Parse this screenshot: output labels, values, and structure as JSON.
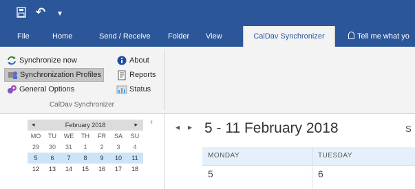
{
  "title_bar": {
    "undo_glyph": "↶",
    "qat_more_glyph": "▾"
  },
  "tabs": [
    {
      "label": "File"
    },
    {
      "label": "Home"
    },
    {
      "label": "Send / Receive"
    },
    {
      "label": "Folder"
    },
    {
      "label": "View"
    },
    {
      "label": "CalDav Synchronizer"
    },
    {
      "label": "Tell me what yo"
    }
  ],
  "ribbon": {
    "buttons": {
      "sync_now": "Synchronize now",
      "profiles": "Synchronization Profiles",
      "general": "General Options",
      "about": "About",
      "reports": "Reports",
      "status": "Status"
    },
    "group_label": "CalDav Synchronizer"
  },
  "mini_calendar": {
    "month": "February 2018",
    "prev": "◂",
    "next": "▸",
    "collapse": "‹",
    "weekdays": [
      "MO",
      "TU",
      "WE",
      "TH",
      "FR",
      "SA",
      "SU"
    ],
    "weeks": [
      [
        "29",
        "30",
        "31",
        "1",
        "2",
        "3",
        "4"
      ],
      [
        "5",
        "6",
        "7",
        "8",
        "9",
        "10",
        "11"
      ],
      [
        "12",
        "13",
        "14",
        "15",
        "16",
        "17",
        "18"
      ]
    ]
  },
  "main": {
    "nav_prev": "◂",
    "nav_next": "▸",
    "range_title": "5 - 11 February 2018",
    "tz_partial": "S",
    "days": [
      {
        "header": "MONDAY",
        "date": "5"
      },
      {
        "header": "TUESDAY",
        "date": "6"
      }
    ]
  },
  "colors": {
    "accent": "#2b579a",
    "ribbon_bg": "#f3f3f3",
    "selected_week": "#cde3f7",
    "day_header_bg": "#e6f0fa"
  }
}
